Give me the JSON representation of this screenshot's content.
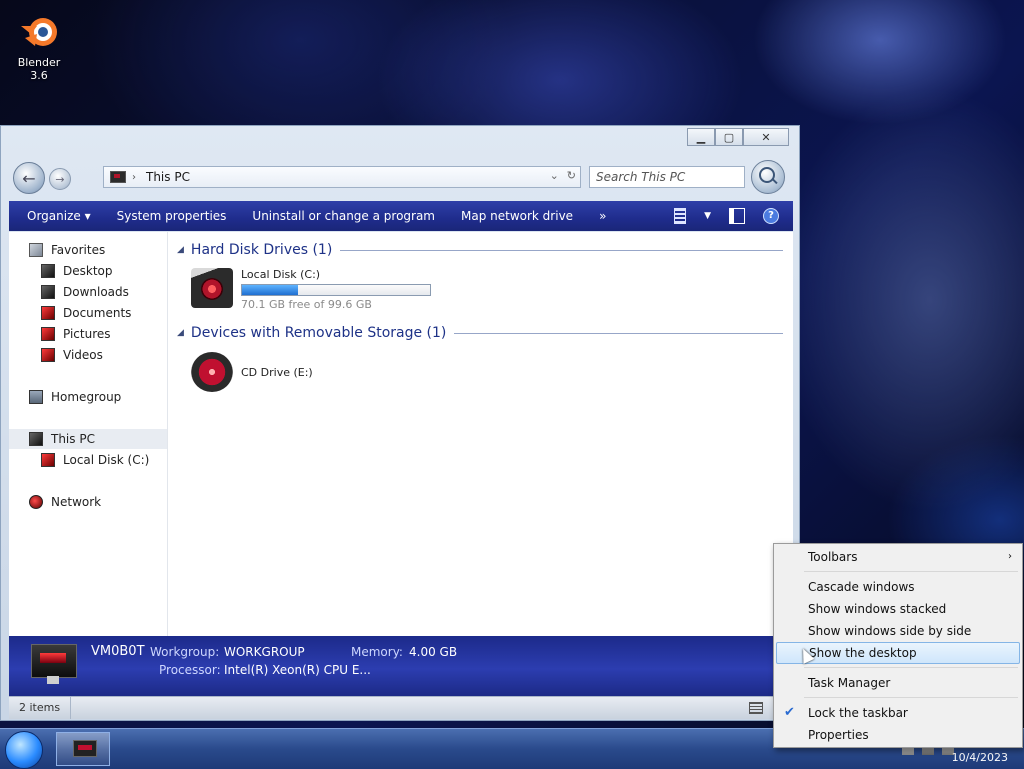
{
  "desktop": {
    "icon_label": "Blender 3.6"
  },
  "window": {
    "controls": {
      "minimize": "▁",
      "maximize": "▢",
      "close": "✕"
    },
    "address": {
      "path": "This PC"
    },
    "search": {
      "placeholder": "Search This PC"
    },
    "commands": [
      "Organize ▾",
      "System properties",
      "Uninstall or change a program",
      "Map network drive",
      "»"
    ],
    "sidebar": {
      "favorites": "Favorites",
      "desktop": "Desktop",
      "downloads": "Downloads",
      "documents": "Documents",
      "pictures": "Pictures",
      "videos": "Videos",
      "homegroup": "Homegroup",
      "this_pc": "This PC",
      "local_disk": "Local Disk (C:)",
      "network": "Network"
    },
    "groups": {
      "hdd": "Hard Disk Drives (1)",
      "removable": "Devices with Removable Storage (1)"
    },
    "drives": {
      "c": {
        "name": "Local Disk (C:)",
        "free": "70.1 GB free of 99.6 GB",
        "used_fraction": 0.3
      },
      "e": {
        "name": "CD Drive (E:)"
      }
    },
    "details": {
      "computer": "VM0B0T",
      "workgroup_label": "Workgroup:",
      "workgroup": "WORKGROUP",
      "memory_label": "Memory:",
      "memory": "4.00 GB",
      "processor_label": "Processor:",
      "processor": "Intel(R) Xeon(R) CPU E..."
    },
    "status": {
      "items": "2 items"
    }
  },
  "taskbar": {
    "clock": "10/4/2023"
  },
  "context_menu": {
    "toolbars": "Toolbars",
    "cascade": "Cascade windows",
    "stacked": "Show windows stacked",
    "side_by_side": "Show windows side by side",
    "show_desktop": "Show the desktop",
    "task_manager": "Task Manager",
    "lock": "Lock the taskbar",
    "properties": "Properties"
  },
  "colors": {
    "command_bar": "#1f2c8c",
    "progress": "#1f6fd1",
    "menu_highlight": "#cfe6fb"
  }
}
